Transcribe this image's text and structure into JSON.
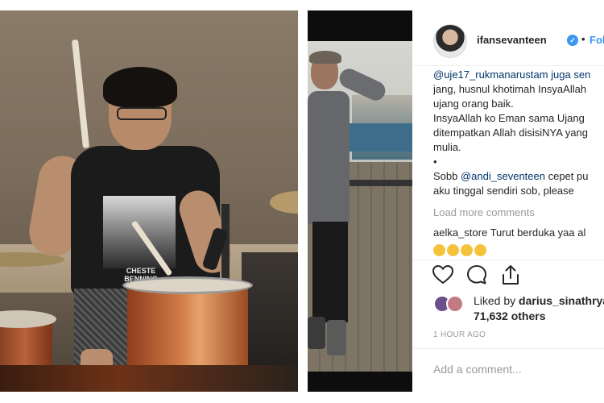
{
  "post": {
    "username": "ifansevanteen",
    "follow_label": "Follo",
    "dot": "•",
    "verified_mark": "✓"
  },
  "photo_left": {
    "shirt_text": "CHESTE BENNING"
  },
  "comments": {
    "lines": [
      "@uje17_rukmanarustam juga sen",
      "jang, husnul khotimah InsyaAllah",
      "ujang orang baik.",
      "InsyaAllah ko Eman sama Ujang",
      "ditempatkan Allah disisiNYA yang",
      "mulia.",
      "•"
    ],
    "sobb_prefix": "Sobb ",
    "sobb_mention": "@andi_seventeen",
    "sobb_suffix": " cepet pu",
    "sobb_line2": "aku tinggal sendiri sob, please",
    "load_more": "Load more comments",
    "last_user": "aelka_store",
    "last_text": " Turut berduka yaa al"
  },
  "likes": {
    "prefix": "Liked by ",
    "user": "darius_sinathrya",
    "count_line": "71,632 others"
  },
  "timestamp": "1 HOUR AGO",
  "add_comment_placeholder": "Add a comment...",
  "icons": [
    "heart-icon",
    "comment-icon",
    "share-icon",
    "verified-badge-icon"
  ],
  "colors": {
    "link": "#003569",
    "follow": "#3897f0",
    "muted": "#999999"
  }
}
